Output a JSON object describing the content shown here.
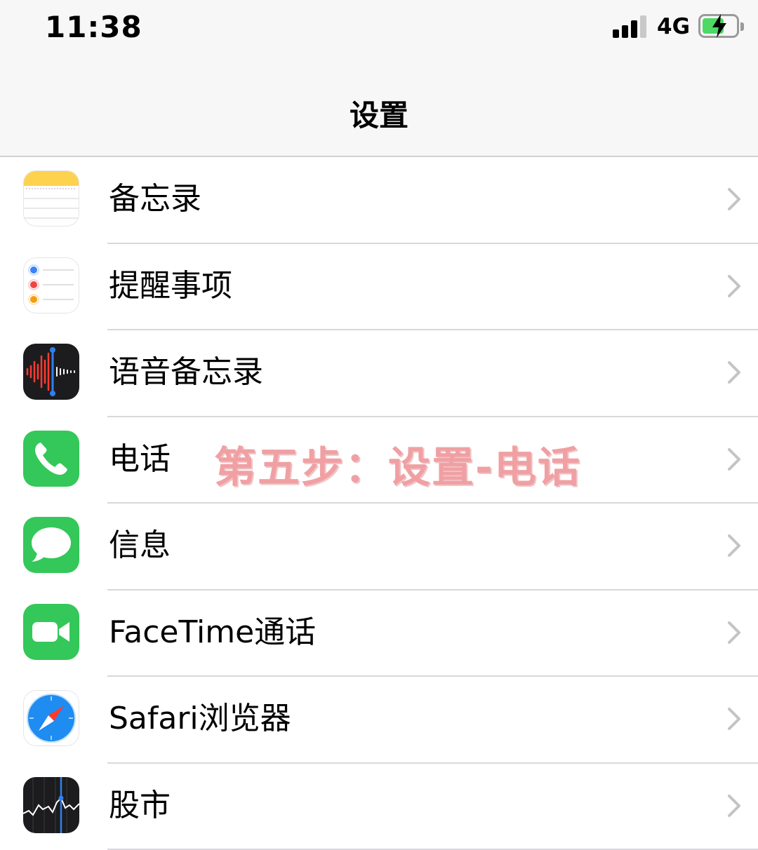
{
  "status_bar": {
    "time": "11:38",
    "network": "4G",
    "signal_bars_filled": 3,
    "signal_bars_total": 4,
    "battery": "charging"
  },
  "nav": {
    "title": "设置"
  },
  "settings_items": [
    {
      "label": "备忘录",
      "icon": "notes-icon"
    },
    {
      "label": "提醒事项",
      "icon": "reminders-icon"
    },
    {
      "label": "语音备忘录",
      "icon": "voice-memos-icon"
    },
    {
      "label": "电话",
      "icon": "phone-icon"
    },
    {
      "label": "信息",
      "icon": "messages-icon"
    },
    {
      "label": "FaceTime通话",
      "icon": "facetime-icon"
    },
    {
      "label": "Safari浏览器",
      "icon": "safari-icon"
    },
    {
      "label": "股市",
      "icon": "stocks-icon"
    }
  ],
  "overlay": {
    "text": "第五步：设置-电话"
  },
  "colors": {
    "nav_background": "#f7f7f7",
    "separator": "#d8d8dc",
    "chevron": "#c4c4c7",
    "battery_fill": "#4cd964",
    "overlay_text": "#f0a0a3"
  }
}
